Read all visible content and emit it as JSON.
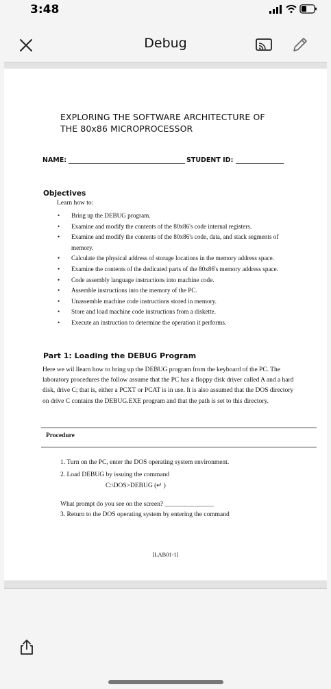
{
  "status_bar": {
    "time": "3:48"
  },
  "toolbar": {
    "title": "Debug"
  },
  "document": {
    "heading_line1": "EXPLORING THE SOFTWARE ARCHITECTURE OF",
    "heading_line2": "THE 80x86 MICROPROCESSOR",
    "name_label": "NAME:",
    "student_id_label": "STUDENT ID:",
    "objectives_title": "Objectives",
    "objectives_lead": "Learn how to:",
    "objectives": [
      "Bring up the DEBUG program.",
      "Examine and modify the contents of the 80x86's code internal registers.",
      "Examine and modify the contents of the 80x86's code, data, and stack segments of memory.",
      "Calculate the physical address of storage locations in the memory address space.",
      "Examine the contents of the dedicated parts of the 80x86's memory address space.",
      "Code assembly language instructions into machine code.",
      "Assemble instructions into the memory of the PC.",
      "Unassemble machine code instructions stored in memory.",
      "Store and load machine code instructions from a diskette.",
      "Execute an instruction to determine the operation it performs."
    ],
    "part1_title": "Part 1: Loading the DEBUG Program",
    "part1_intro": "Here we wil llearn how to bring up the DEBUG program from the keyboard of the PC. The laboratory procedures the follow assume that the PC has a floppy disk driver called A and a hard disk, drive C; that is, either a PCXT or PCAT is in use. It is also assumed that the DOS directory on drive C contains the DEBUG.EXE program and that the path is set to this directory.",
    "procedure_label": "Procedure",
    "step1": "1. Turn on the PC, enter the DOS operating system environment.",
    "step2": "2. Load DEBUG by issuing the command",
    "command": "C:\\DOS>DEBUG (↵ )",
    "question": "What prompt do you see on the screen? _______________",
    "step3": "3. Return to the DOS operating system by entering the command",
    "page_label": "[LAB01-1]"
  }
}
